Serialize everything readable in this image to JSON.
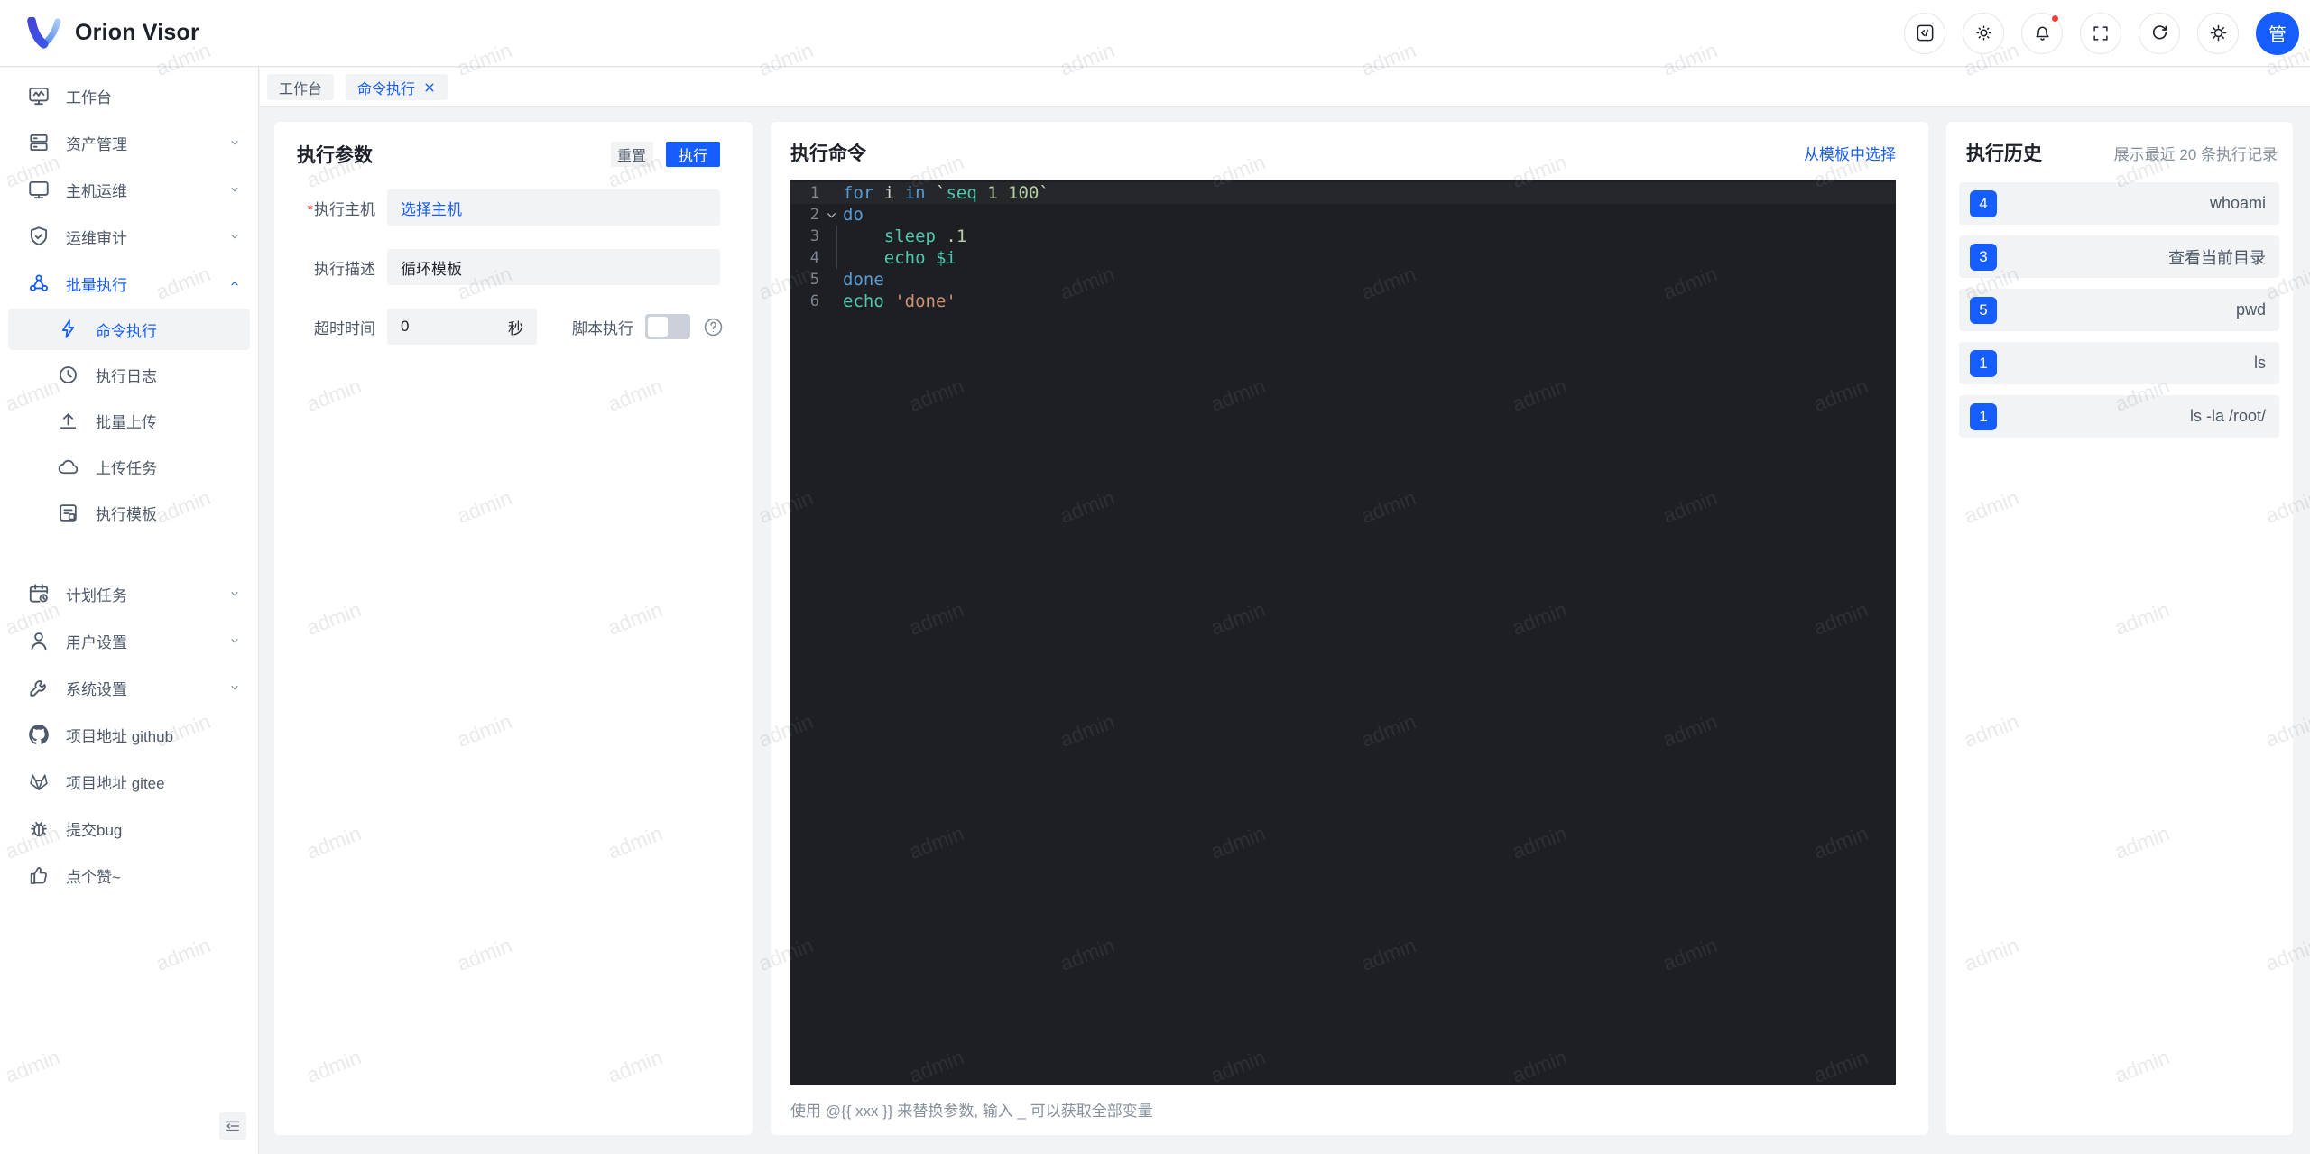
{
  "header": {
    "logo_text": "Orion Visor",
    "avatar_text": "管",
    "icons": [
      "code-square-icon",
      "theme-sun-icon",
      "notification-bell-icon",
      "fullscreen-icon",
      "refresh-icon",
      "settings-gear-icon"
    ],
    "notification_has_dot": true
  },
  "tabs": [
    {
      "label": "工作台",
      "active": false,
      "closable": false
    },
    {
      "label": "命令执行",
      "active": true,
      "closable": true
    }
  ],
  "sidebar": {
    "items": [
      {
        "label": "工作台",
        "icon": "workbench"
      },
      {
        "label": "资产管理",
        "icon": "assets",
        "chevron": "down"
      },
      {
        "label": "主机运维",
        "icon": "host-ops",
        "chevron": "down"
      },
      {
        "label": "运维审计",
        "icon": "ops-audit",
        "chevron": "down"
      },
      {
        "label": "批量执行",
        "icon": "batch-exec",
        "chevron": "up",
        "active": true
      },
      {
        "label": "计划任务",
        "icon": "schedule",
        "chevron": "down"
      },
      {
        "label": "用户设置",
        "icon": "user-settings",
        "chevron": "down"
      },
      {
        "label": "系统设置",
        "icon": "system-settings",
        "chevron": "down"
      },
      {
        "label": "项目地址 github",
        "icon": "github"
      },
      {
        "label": "项目地址 gitee",
        "icon": "gitee"
      },
      {
        "label": "提交bug",
        "icon": "bug"
      },
      {
        "label": "点个赞~",
        "icon": "thumbs-up"
      }
    ],
    "submenu": [
      {
        "label": "命令执行",
        "icon": "lightning",
        "selected": true
      },
      {
        "label": "执行日志",
        "icon": "exec-log"
      },
      {
        "label": "批量上传",
        "icon": "batch-upload"
      },
      {
        "label": "上传任务",
        "icon": "upload-tasks"
      },
      {
        "label": "执行模板",
        "icon": "exec-template"
      }
    ]
  },
  "params": {
    "title": "执行参数",
    "reset_label": "重置",
    "run_label": "执行",
    "host_label": "执行主机",
    "host_value": "选择主机",
    "desc_label": "执行描述",
    "desc_value": "循环模板",
    "timeout_label": "超时时间",
    "timeout_value": "0",
    "timeout_unit": "秒",
    "script_label": "脚本执行",
    "script_enabled": false
  },
  "command": {
    "title": "执行命令",
    "template_link": "从模板中选择",
    "hint": "使用 @{{ xxx }} 来替换参数, 输入 _ 可以获取全部变量",
    "editor": {
      "lines": [
        {
          "no": "1",
          "hl": true,
          "tokens": [
            [
              "for",
              "kw"
            ],
            [
              " i ",
              "pl"
            ],
            [
              "in",
              "kw"
            ],
            [
              " `",
              "pl"
            ],
            [
              "seq",
              "fn"
            ],
            [
              " ",
              "pl"
            ],
            [
              "1 100",
              "num"
            ],
            [
              "`",
              "pl"
            ]
          ]
        },
        {
          "no": "2",
          "fold": true,
          "tokens": [
            [
              "do",
              "kw"
            ]
          ]
        },
        {
          "no": "3",
          "guide": true,
          "tokens": [
            [
              "    ",
              "pl"
            ],
            [
              "sleep",
              "fn"
            ],
            [
              " ",
              "pl"
            ],
            [
              ".1",
              "num"
            ]
          ]
        },
        {
          "no": "4",
          "guide": true,
          "tokens": [
            [
              "    ",
              "pl"
            ],
            [
              "echo",
              "fn"
            ],
            [
              " ",
              "pl"
            ],
            [
              "$i",
              "var"
            ]
          ]
        },
        {
          "no": "5",
          "tokens": [
            [
              "done",
              "kw"
            ]
          ]
        },
        {
          "no": "6",
          "tokens": [
            [
              "echo",
              "fn"
            ],
            [
              " ",
              "pl"
            ],
            [
              "'done'",
              "str"
            ]
          ]
        }
      ]
    }
  },
  "history": {
    "title": "执行历史",
    "subtitle": "展示最近 20 条执行记录",
    "items": [
      {
        "count": "4",
        "command": "whoami"
      },
      {
        "count": "3",
        "command": "查看当前目录"
      },
      {
        "count": "5",
        "command": "pwd"
      },
      {
        "count": "1",
        "command": "ls"
      },
      {
        "count": "1",
        "command": "ls -la /root/"
      }
    ]
  },
  "watermark": {
    "text": "admin"
  },
  "colors": {
    "primary": "#165DFF",
    "danger": "#F53F3F",
    "page_bg": "#F2F3F5",
    "border": "#E5E6EB",
    "text": "#1D2129",
    "text_secondary": "#4E5969",
    "text_muted": "#86909C",
    "editor_bg": "#1E1F22",
    "token_keyword": "#569CD6",
    "token_builtin": "#4EC9B0",
    "token_number": "#B5CEA8",
    "token_string": "#CE9178"
  }
}
